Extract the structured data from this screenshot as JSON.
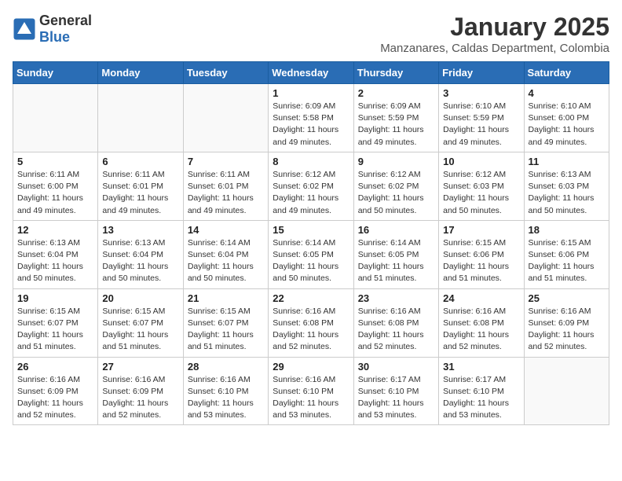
{
  "header": {
    "logo_general": "General",
    "logo_blue": "Blue",
    "month": "January 2025",
    "location": "Manzanares, Caldas Department, Colombia"
  },
  "weekdays": [
    "Sunday",
    "Monday",
    "Tuesday",
    "Wednesday",
    "Thursday",
    "Friday",
    "Saturday"
  ],
  "weeks": [
    [
      {
        "day": "",
        "info": ""
      },
      {
        "day": "",
        "info": ""
      },
      {
        "day": "",
        "info": ""
      },
      {
        "day": "1",
        "info": "Sunrise: 6:09 AM\nSunset: 5:58 PM\nDaylight: 11 hours\nand 49 minutes."
      },
      {
        "day": "2",
        "info": "Sunrise: 6:09 AM\nSunset: 5:59 PM\nDaylight: 11 hours\nand 49 minutes."
      },
      {
        "day": "3",
        "info": "Sunrise: 6:10 AM\nSunset: 5:59 PM\nDaylight: 11 hours\nand 49 minutes."
      },
      {
        "day": "4",
        "info": "Sunrise: 6:10 AM\nSunset: 6:00 PM\nDaylight: 11 hours\nand 49 minutes."
      }
    ],
    [
      {
        "day": "5",
        "info": "Sunrise: 6:11 AM\nSunset: 6:00 PM\nDaylight: 11 hours\nand 49 minutes."
      },
      {
        "day": "6",
        "info": "Sunrise: 6:11 AM\nSunset: 6:01 PM\nDaylight: 11 hours\nand 49 minutes."
      },
      {
        "day": "7",
        "info": "Sunrise: 6:11 AM\nSunset: 6:01 PM\nDaylight: 11 hours\nand 49 minutes."
      },
      {
        "day": "8",
        "info": "Sunrise: 6:12 AM\nSunset: 6:02 PM\nDaylight: 11 hours\nand 49 minutes."
      },
      {
        "day": "9",
        "info": "Sunrise: 6:12 AM\nSunset: 6:02 PM\nDaylight: 11 hours\nand 50 minutes."
      },
      {
        "day": "10",
        "info": "Sunrise: 6:12 AM\nSunset: 6:03 PM\nDaylight: 11 hours\nand 50 minutes."
      },
      {
        "day": "11",
        "info": "Sunrise: 6:13 AM\nSunset: 6:03 PM\nDaylight: 11 hours\nand 50 minutes."
      }
    ],
    [
      {
        "day": "12",
        "info": "Sunrise: 6:13 AM\nSunset: 6:04 PM\nDaylight: 11 hours\nand 50 minutes."
      },
      {
        "day": "13",
        "info": "Sunrise: 6:13 AM\nSunset: 6:04 PM\nDaylight: 11 hours\nand 50 minutes."
      },
      {
        "day": "14",
        "info": "Sunrise: 6:14 AM\nSunset: 6:04 PM\nDaylight: 11 hours\nand 50 minutes."
      },
      {
        "day": "15",
        "info": "Sunrise: 6:14 AM\nSunset: 6:05 PM\nDaylight: 11 hours\nand 50 minutes."
      },
      {
        "day": "16",
        "info": "Sunrise: 6:14 AM\nSunset: 6:05 PM\nDaylight: 11 hours\nand 51 minutes."
      },
      {
        "day": "17",
        "info": "Sunrise: 6:15 AM\nSunset: 6:06 PM\nDaylight: 11 hours\nand 51 minutes."
      },
      {
        "day": "18",
        "info": "Sunrise: 6:15 AM\nSunset: 6:06 PM\nDaylight: 11 hours\nand 51 minutes."
      }
    ],
    [
      {
        "day": "19",
        "info": "Sunrise: 6:15 AM\nSunset: 6:07 PM\nDaylight: 11 hours\nand 51 minutes."
      },
      {
        "day": "20",
        "info": "Sunrise: 6:15 AM\nSunset: 6:07 PM\nDaylight: 11 hours\nand 51 minutes."
      },
      {
        "day": "21",
        "info": "Sunrise: 6:15 AM\nSunset: 6:07 PM\nDaylight: 11 hours\nand 51 minutes."
      },
      {
        "day": "22",
        "info": "Sunrise: 6:16 AM\nSunset: 6:08 PM\nDaylight: 11 hours\nand 52 minutes."
      },
      {
        "day": "23",
        "info": "Sunrise: 6:16 AM\nSunset: 6:08 PM\nDaylight: 11 hours\nand 52 minutes."
      },
      {
        "day": "24",
        "info": "Sunrise: 6:16 AM\nSunset: 6:08 PM\nDaylight: 11 hours\nand 52 minutes."
      },
      {
        "day": "25",
        "info": "Sunrise: 6:16 AM\nSunset: 6:09 PM\nDaylight: 11 hours\nand 52 minutes."
      }
    ],
    [
      {
        "day": "26",
        "info": "Sunrise: 6:16 AM\nSunset: 6:09 PM\nDaylight: 11 hours\nand 52 minutes."
      },
      {
        "day": "27",
        "info": "Sunrise: 6:16 AM\nSunset: 6:09 PM\nDaylight: 11 hours\nand 52 minutes."
      },
      {
        "day": "28",
        "info": "Sunrise: 6:16 AM\nSunset: 6:10 PM\nDaylight: 11 hours\nand 53 minutes."
      },
      {
        "day": "29",
        "info": "Sunrise: 6:16 AM\nSunset: 6:10 PM\nDaylight: 11 hours\nand 53 minutes."
      },
      {
        "day": "30",
        "info": "Sunrise: 6:17 AM\nSunset: 6:10 PM\nDaylight: 11 hours\nand 53 minutes."
      },
      {
        "day": "31",
        "info": "Sunrise: 6:17 AM\nSunset: 6:10 PM\nDaylight: 11 hours\nand 53 minutes."
      },
      {
        "day": "",
        "info": ""
      }
    ]
  ]
}
